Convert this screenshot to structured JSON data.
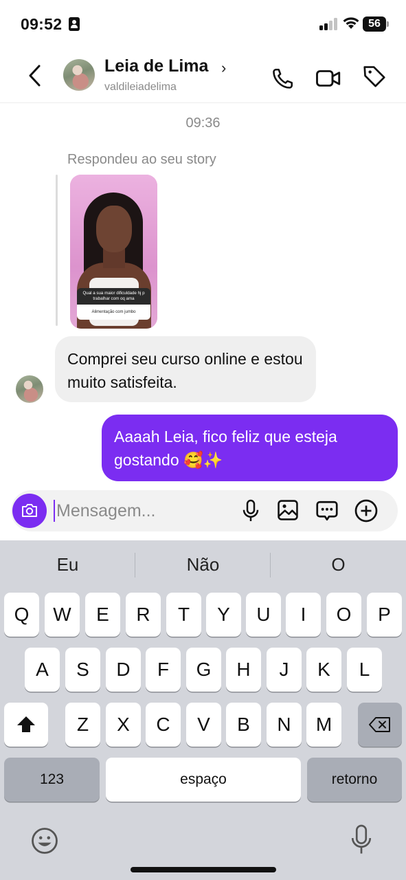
{
  "status_bar": {
    "time": "09:52",
    "battery": "56"
  },
  "header": {
    "contact_name": "Leia de Lima",
    "contact_handle": "valdileiadelima",
    "icons": [
      "back-chevron-icon",
      "phone-icon",
      "video-call-icon",
      "tag-icon"
    ]
  },
  "chat": {
    "timestamp": "09:36",
    "story_reply_label": "Respondeu ao seu story",
    "story": {
      "question": "Qual a sua maior dificuldade hj p trabalhar com oq ama",
      "answer": "Alimentação com jumbo"
    },
    "messages": [
      {
        "direction": "incoming",
        "text": "Comprei seu curso online e estou muito satisfeita."
      },
      {
        "direction": "outgoing",
        "text": "Aaaah Leia, fico feliz que esteja gostando 🥰✨"
      }
    ]
  },
  "composer": {
    "placeholder": "Mensagem...",
    "value": "",
    "icons": [
      "camera-icon",
      "microphone-icon",
      "gallery-icon",
      "sticker-icon",
      "plus-icon"
    ]
  },
  "keyboard": {
    "suggestions": [
      "Eu",
      "Não",
      "O"
    ],
    "rows": [
      [
        "Q",
        "W",
        "E",
        "R",
        "T",
        "Y",
        "U",
        "I",
        "O",
        "P"
      ],
      [
        "A",
        "S",
        "D",
        "F",
        "G",
        "H",
        "J",
        "K",
        "L"
      ],
      [
        "Z",
        "X",
        "C",
        "V",
        "B",
        "N",
        "M"
      ]
    ],
    "numbers_key": "123",
    "space_key": "espaço",
    "return_key": "retorno"
  },
  "colors": {
    "accent": "#7b2df1",
    "incoming_bubble": "#efefef",
    "keyboard_bg": "#d3d5db"
  }
}
